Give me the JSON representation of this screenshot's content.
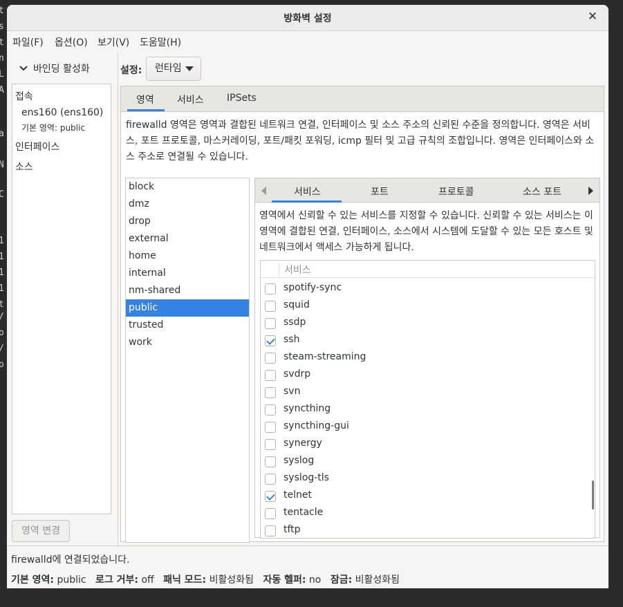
{
  "window": {
    "title": "방화벽 설정"
  },
  "menu": [
    "파일(F)",
    "옵션(O)",
    "보기(V)",
    "도움말(H)"
  ],
  "sidebar": {
    "binding_toggle": "바인딩 활성화",
    "connections_header": "접속",
    "connection_name": "ens160 (ens160)",
    "connection_zone": "기본 영역: public",
    "interfaces_header": "인터페이스",
    "sources_header": "소스",
    "change_zone_button": "영역 변경"
  },
  "config": {
    "label": "설정:",
    "value": "런타임"
  },
  "main_tabs": [
    "영역",
    "서비스",
    "IPSets"
  ],
  "zones_description": "firewalld 영역은 영역과 결합된 네트워크 연결, 인터페이스 및 소스 주소의 신뢰된 수준을 정의합니다. 영역은 서비스, 포트 프로토콜, 마스커레이딩, 포트/패킷 포워딩, icmp 필터 및 고급 규칙의 조합입니다. 영역은 인터페이스와 소스 주소로 연결될 수 있습니다.",
  "zones": [
    "block",
    "dmz",
    "drop",
    "external",
    "home",
    "internal",
    "nm-shared",
    "public",
    "trusted",
    "work"
  ],
  "selected_zone": "public",
  "sub_tabs": [
    "서비스",
    "포트",
    "프로토콜",
    "소스 포트"
  ],
  "services_description": "영역에서 신뢰할 수 있는 서비스를 지정할 수 있습니다. 신뢰할 수 있는 서비스는 이 영역에 결합된 연결, 인터페이스, 소스에서 시스템에 도달할 수 있는 모든 호스트 및 네트워크에서 액세스 가능하게 됩니다.",
  "services_column": "서비스",
  "services": [
    {
      "name": "spotify-sync",
      "checked": false
    },
    {
      "name": "squid",
      "checked": false
    },
    {
      "name": "ssdp",
      "checked": false
    },
    {
      "name": "ssh",
      "checked": true
    },
    {
      "name": "steam-streaming",
      "checked": false
    },
    {
      "name": "svdrp",
      "checked": false
    },
    {
      "name": "svn",
      "checked": false
    },
    {
      "name": "syncthing",
      "checked": false
    },
    {
      "name": "syncthing-gui",
      "checked": false
    },
    {
      "name": "synergy",
      "checked": false
    },
    {
      "name": "syslog",
      "checked": false
    },
    {
      "name": "syslog-tls",
      "checked": false
    },
    {
      "name": "telnet",
      "checked": true
    },
    {
      "name": "tentacle",
      "checked": false
    },
    {
      "name": "tftp",
      "checked": false
    }
  ],
  "status": {
    "message": "firewalld에 연결되었습니다.",
    "default_zone_label": "기본 영역:",
    "default_zone": "public",
    "log_denied_label": "로그 거부:",
    "log_denied": "off",
    "panic_label": "패닉 모드:",
    "panic": "비활성화됨",
    "helpers_label": "자동 헬퍼:",
    "helpers": "no",
    "lockdown_label": "잠금:",
    "lockdown": "비활성화됨"
  },
  "colors": {
    "accent": "#3584e4",
    "window_bg": "#f6f5f4"
  }
}
